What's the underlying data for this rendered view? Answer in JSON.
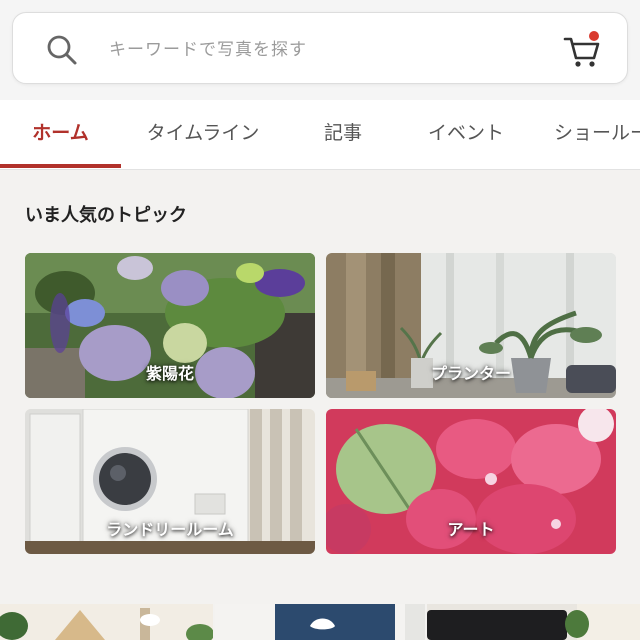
{
  "search": {
    "placeholder": "キーワードで写真を探す"
  },
  "tabs": [
    {
      "label": "ホーム",
      "active": true
    },
    {
      "label": "タイムライン",
      "active": false
    },
    {
      "label": "記事",
      "active": false
    },
    {
      "label": "イベント",
      "active": false
    },
    {
      "label": "ショールー",
      "active": false
    }
  ],
  "popular": {
    "title": "いま人気のトピック",
    "cards": [
      {
        "label": "紫陽花"
      },
      {
        "label": "プランター"
      },
      {
        "label": "ランドリールーム"
      },
      {
        "label": "アート"
      }
    ]
  },
  "colors": {
    "accent": "#b1312b",
    "badge": "#d93a2e"
  },
  "icons": {
    "search": "search-icon",
    "cart": "cart-icon"
  }
}
